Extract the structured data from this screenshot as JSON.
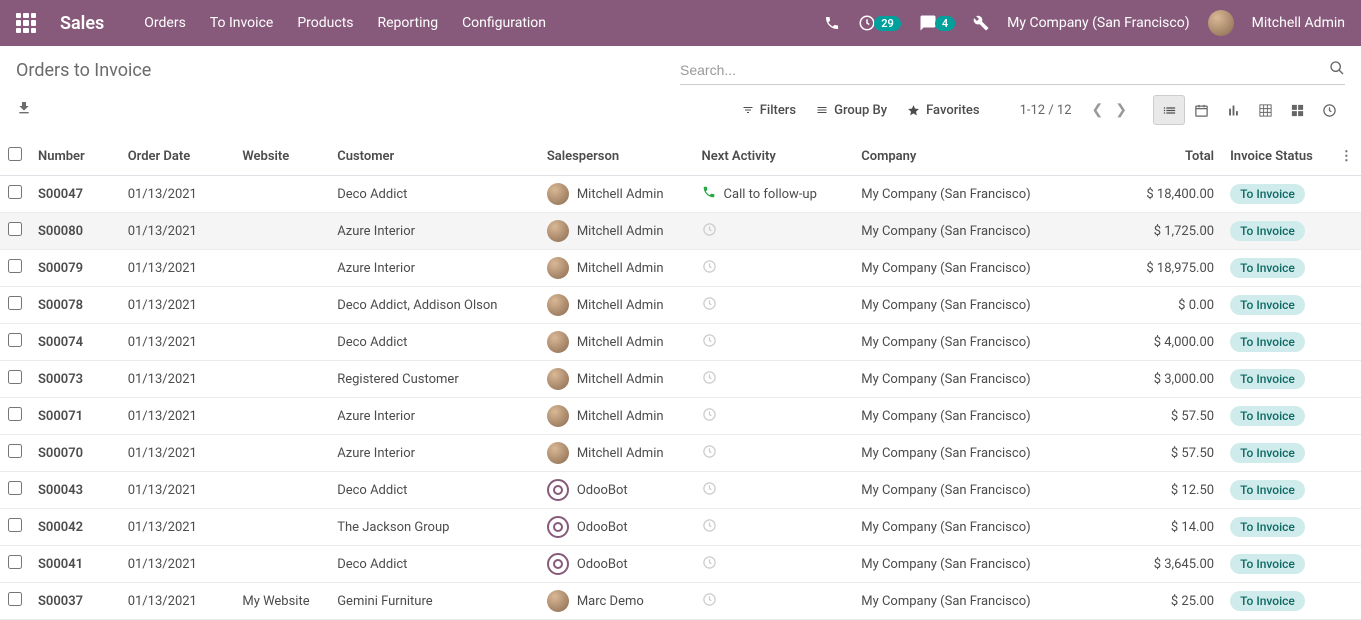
{
  "topbar": {
    "brand": "Sales",
    "nav": [
      "Orders",
      "To Invoice",
      "Products",
      "Reporting",
      "Configuration"
    ],
    "activity_count": "29",
    "msg_count": "4",
    "company": "My Company (San Francisco)",
    "user": "Mitchell Admin"
  },
  "page": {
    "title": "Orders to Invoice",
    "search_placeholder": "Search...",
    "filters": "Filters",
    "group_by": "Group By",
    "favorites": "Favorites",
    "pager": "1-12 / 12"
  },
  "columns": {
    "number": "Number",
    "order_date": "Order Date",
    "website": "Website",
    "customer": "Customer",
    "salesperson": "Salesperson",
    "next_activity": "Next Activity",
    "company": "Company",
    "total": "Total",
    "invoice_status": "Invoice Status"
  },
  "status_label": "To Invoice",
  "rows": [
    {
      "num": "S00047",
      "date": "01/13/2021",
      "web": "",
      "cust": "Deco Addict",
      "sp": "Mitchell Admin",
      "sp_type": "user",
      "act": "Call to follow-up",
      "act_icon": "phone",
      "comp": "My Company (San Francisco)",
      "total": "$ 18,400.00"
    },
    {
      "num": "S00080",
      "date": "01/13/2021",
      "web": "",
      "cust": "Azure Interior",
      "sp": "Mitchell Admin",
      "sp_type": "user",
      "act": "",
      "act_icon": "clock",
      "comp": "My Company (San Francisco)",
      "total": "$ 1,725.00"
    },
    {
      "num": "S00079",
      "date": "01/13/2021",
      "web": "",
      "cust": "Azure Interior",
      "sp": "Mitchell Admin",
      "sp_type": "user",
      "act": "",
      "act_icon": "clock",
      "comp": "My Company (San Francisco)",
      "total": "$ 18,975.00"
    },
    {
      "num": "S00078",
      "date": "01/13/2021",
      "web": "",
      "cust": "Deco Addict, Addison Olson",
      "sp": "Mitchell Admin",
      "sp_type": "user",
      "act": "",
      "act_icon": "clock",
      "comp": "My Company (San Francisco)",
      "total": "$ 0.00"
    },
    {
      "num": "S00074",
      "date": "01/13/2021",
      "web": "",
      "cust": "Deco Addict",
      "sp": "Mitchell Admin",
      "sp_type": "user",
      "act": "",
      "act_icon": "clock",
      "comp": "My Company (San Francisco)",
      "total": "$ 4,000.00"
    },
    {
      "num": "S00073",
      "date": "01/13/2021",
      "web": "",
      "cust": "Registered Customer",
      "sp": "Mitchell Admin",
      "sp_type": "user",
      "act": "",
      "act_icon": "clock",
      "comp": "My Company (San Francisco)",
      "total": "$ 3,000.00"
    },
    {
      "num": "S00071",
      "date": "01/13/2021",
      "web": "",
      "cust": "Azure Interior",
      "sp": "Mitchell Admin",
      "sp_type": "user",
      "act": "",
      "act_icon": "clock",
      "comp": "My Company (San Francisco)",
      "total": "$ 57.50"
    },
    {
      "num": "S00070",
      "date": "01/13/2021",
      "web": "",
      "cust": "Azure Interior",
      "sp": "Mitchell Admin",
      "sp_type": "user",
      "act": "",
      "act_icon": "clock",
      "comp": "My Company (San Francisco)",
      "total": "$ 57.50"
    },
    {
      "num": "S00043",
      "date": "01/13/2021",
      "web": "",
      "cust": "Deco Addict",
      "sp": "OdooBot",
      "sp_type": "bot",
      "act": "",
      "act_icon": "clock",
      "comp": "My Company (San Francisco)",
      "total": "$ 12.50"
    },
    {
      "num": "S00042",
      "date": "01/13/2021",
      "web": "",
      "cust": "The Jackson Group",
      "sp": "OdooBot",
      "sp_type": "bot",
      "act": "",
      "act_icon": "clock",
      "comp": "My Company (San Francisco)",
      "total": "$ 14.00"
    },
    {
      "num": "S00041",
      "date": "01/13/2021",
      "web": "",
      "cust": "Deco Addict",
      "sp": "OdooBot",
      "sp_type": "bot",
      "act": "",
      "act_icon": "clock",
      "comp": "My Company (San Francisco)",
      "total": "$ 3,645.00"
    },
    {
      "num": "S00037",
      "date": "01/13/2021",
      "web": "My Website",
      "cust": "Gemini Furniture",
      "sp": "Marc Demo",
      "sp_type": "user",
      "act": "",
      "act_icon": "clock",
      "comp": "My Company (San Francisco)",
      "total": "$ 25.00"
    }
  ]
}
